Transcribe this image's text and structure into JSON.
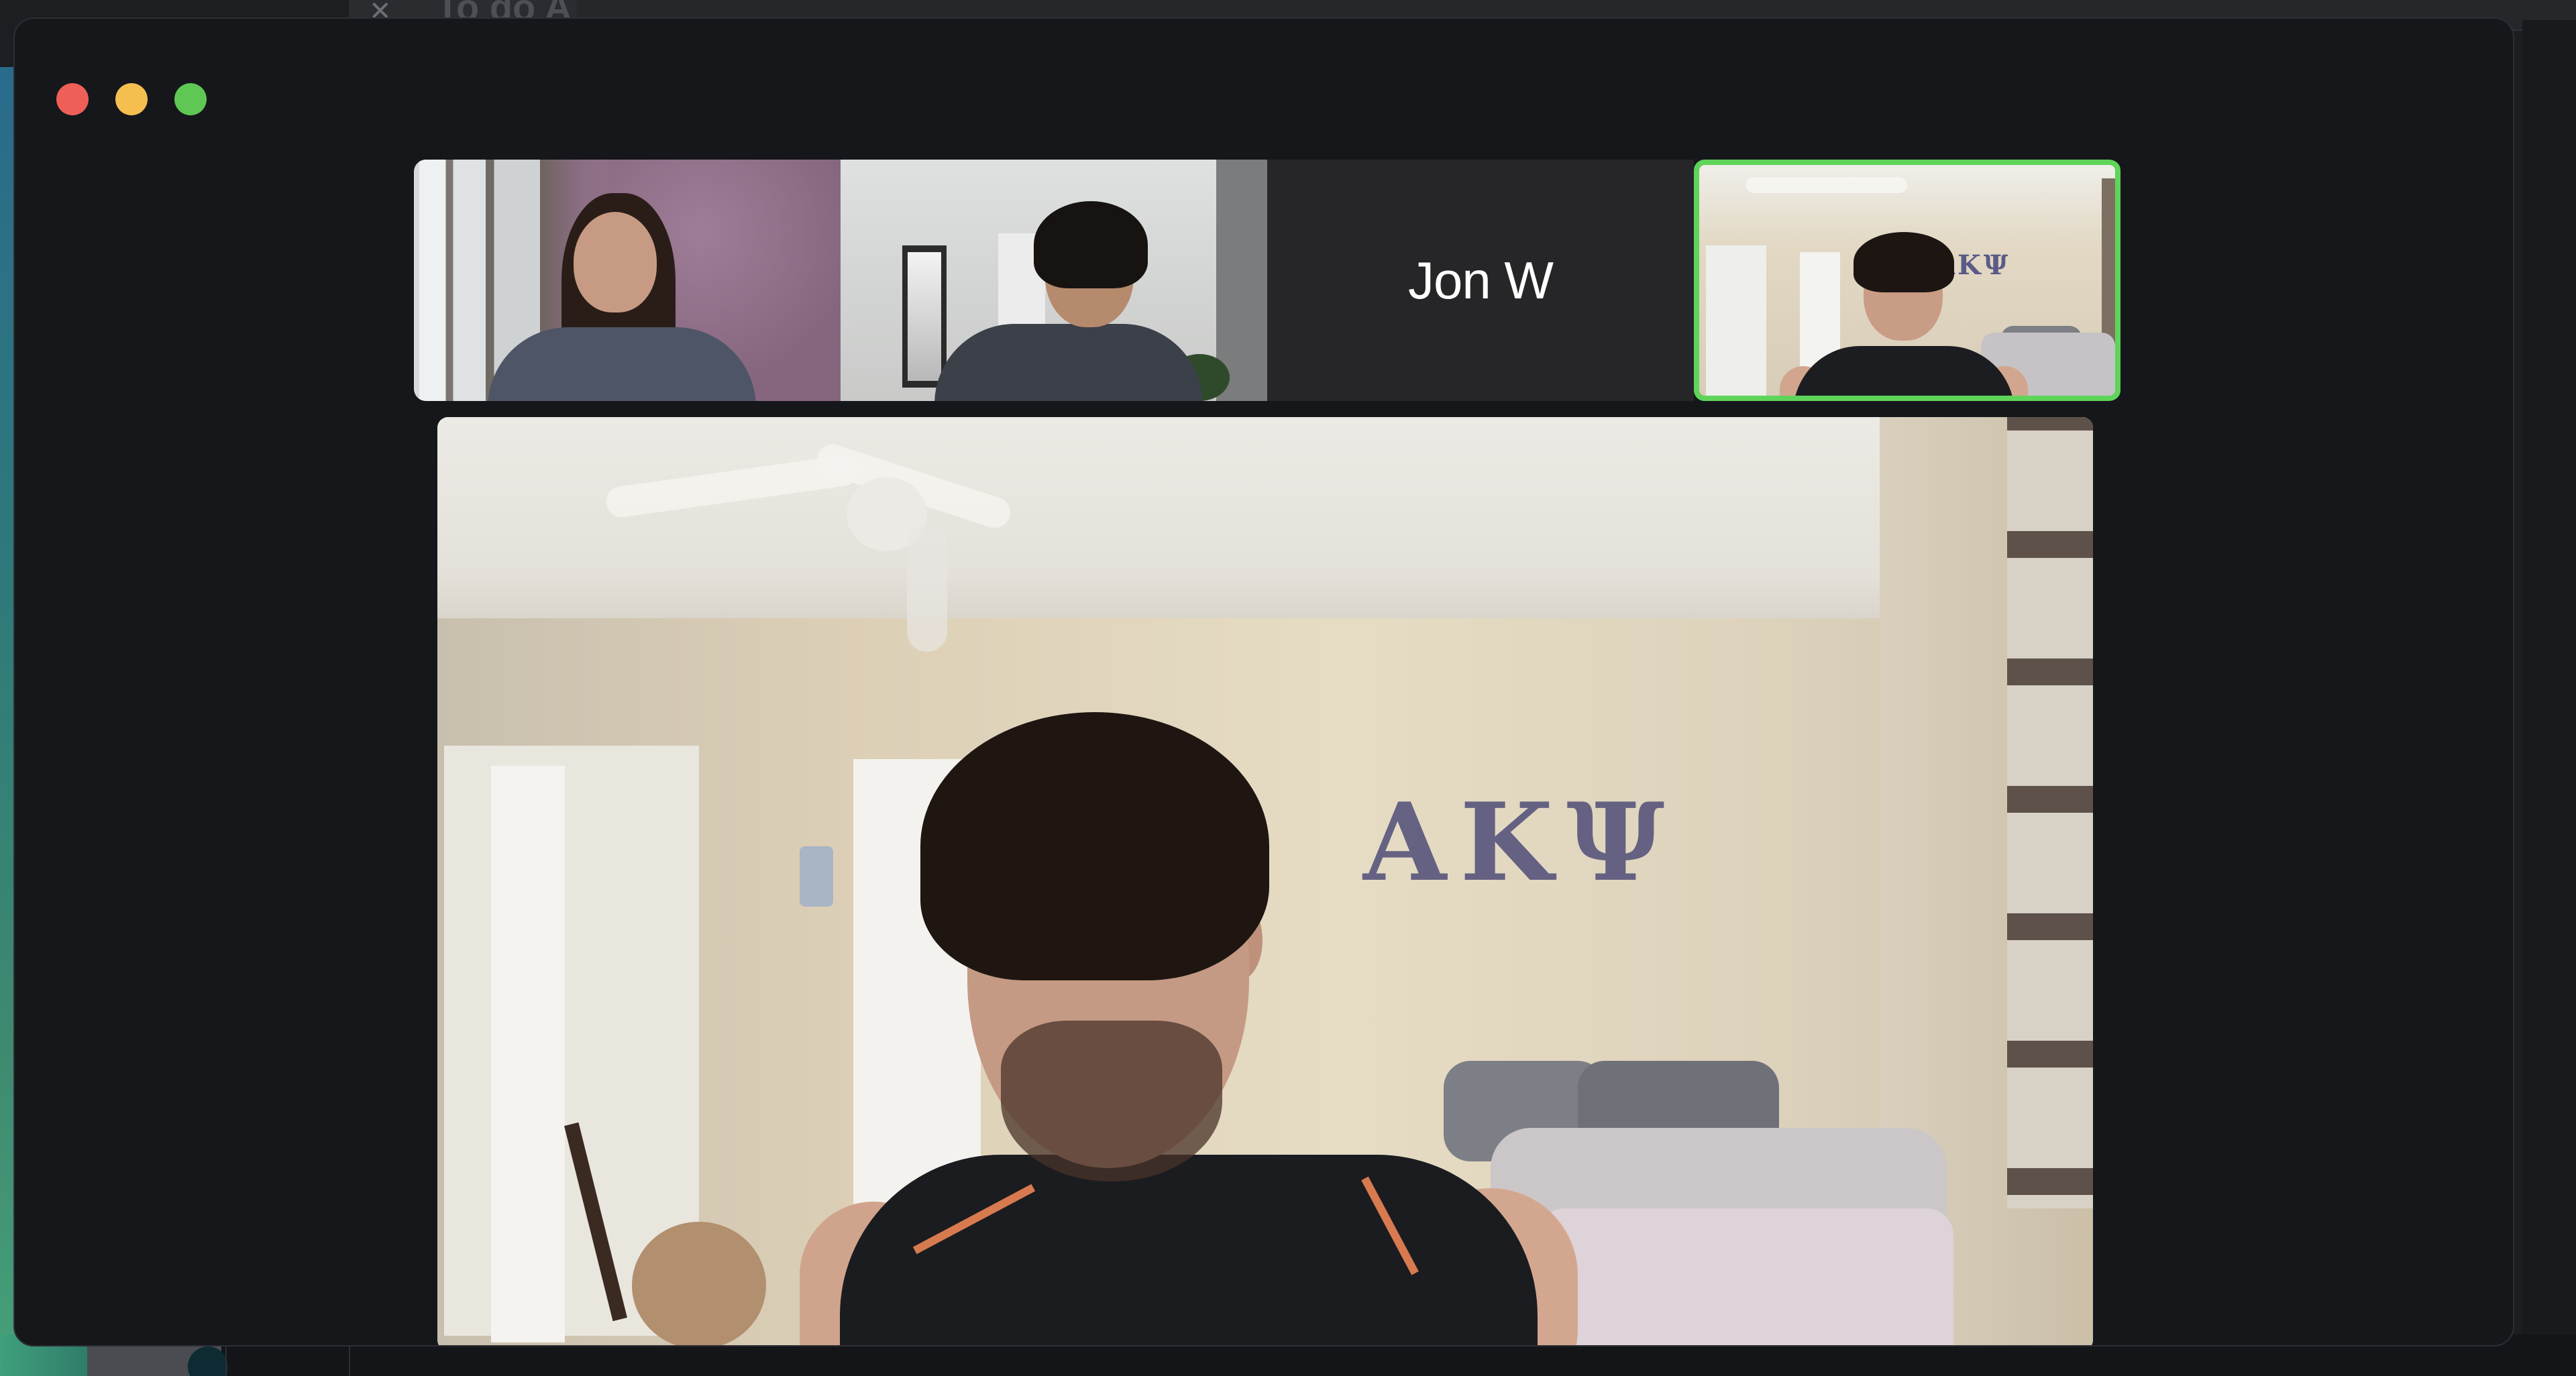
{
  "background_window": {
    "title": "To do A"
  },
  "window": {
    "controls": {
      "close_icon": "close-icon",
      "minimize_icon": "minimize-icon",
      "zoom_icon": "zoom-icon"
    }
  },
  "filmstrip": {
    "participants": [
      {
        "kind": "video"
      },
      {
        "kind": "video"
      },
      {
        "kind": "name",
        "name": "Jon W"
      },
      {
        "kind": "video",
        "active_speaker": true,
        "wall_text": "AKΨ"
      }
    ]
  },
  "main_video": {
    "wall_text": "AKΨ"
  },
  "colors": {
    "active_speaker_border": "#5fd45a",
    "window_bg": "#15171b",
    "traffic_close": "#ed5f57",
    "traffic_minimize": "#f5bf4f",
    "traffic_zoom": "#5fc753"
  }
}
